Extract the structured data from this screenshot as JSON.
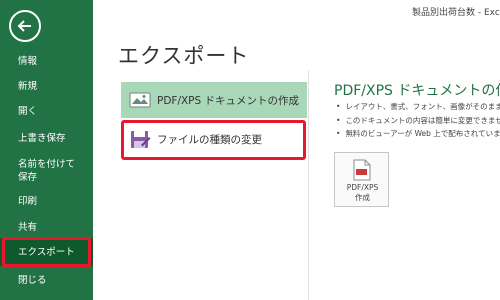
{
  "window": {
    "title": "製品別出荷台数 - Excel"
  },
  "sidebar": {
    "items": [
      {
        "label": "情報"
      },
      {
        "label": "新規"
      },
      {
        "label": "開く"
      },
      {
        "label": "上書き保存"
      },
      {
        "label": "名前を付けて\n保存"
      },
      {
        "label": "印刷"
      },
      {
        "label": "共有"
      },
      {
        "label": "エクスポート",
        "active": true
      },
      {
        "label": "閉じる"
      }
    ]
  },
  "main": {
    "title": "エクスポート",
    "options": [
      {
        "label": "PDF/XPS ドキュメントの作成",
        "selected": true
      },
      {
        "label": "ファイルの種類の変更"
      }
    ],
    "detail": {
      "title": "PDF/XPS ドキュメントの作成",
      "bullets": [
        "レイアウト、書式、フォント、画像がそのまま維持",
        "このドキュメントの内容は簡単に変更できませ",
        "無料のビューアーが Web 上で配布されていま"
      ],
      "button_label": "PDF/XPS\n作成"
    }
  },
  "colors": {
    "sidebar": "#217346",
    "active": "#0f5a2c",
    "selected_option": "#a9d8b8",
    "highlight": "#e8192c"
  }
}
